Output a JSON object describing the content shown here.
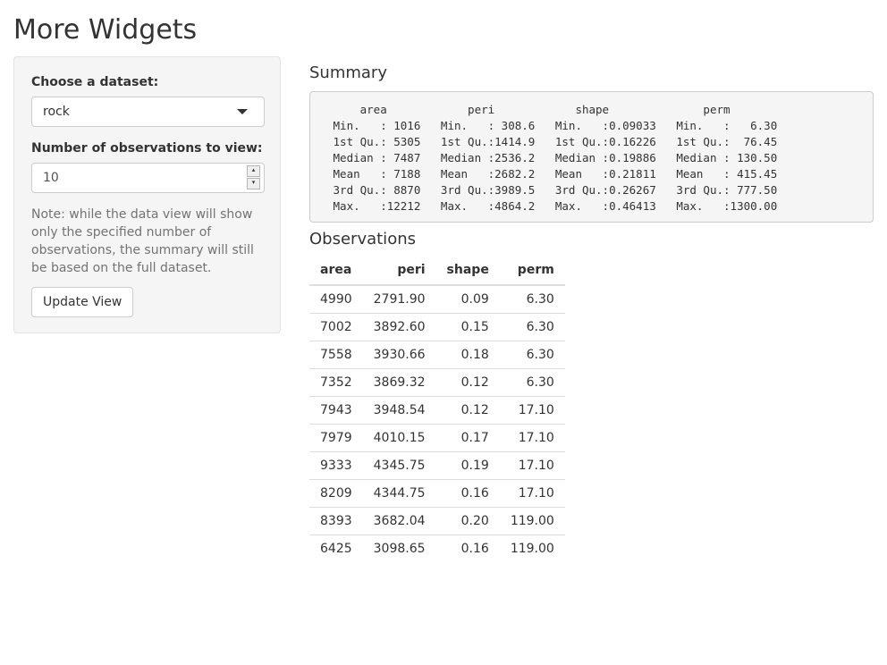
{
  "app": {
    "title": "More Widgets"
  },
  "sidebar": {
    "dataset_label": "Choose a dataset:",
    "dataset_value": "rock",
    "obs_label": "Number of observations to view:",
    "obs_value": "10",
    "note": "Note: while the data view will show only the specified number of observations, the summary will still be based on the full dataset.",
    "update_button": "Update View"
  },
  "main": {
    "summary_heading": "Summary",
    "summary_text": "     area            peri            shape              perm        \n Min.   : 1016   Min.   : 308.6   Min.   :0.09033   Min.   :   6.30  \n 1st Qu.: 5305   1st Qu.:1414.9   1st Qu.:0.16226   1st Qu.:  76.45  \n Median : 7487   Median :2536.2   Median :0.19886   Median : 130.50  \n Mean   : 7188   Mean   :2682.2   Mean   :0.21811   Mean   : 415.45  \n 3rd Qu.: 8870   3rd Qu.:3989.5   3rd Qu.:0.26267   3rd Qu.: 777.50  \n Max.   :12212   Max.   :4864.2   Max.   :0.46413   Max.   :1300.00  ",
    "observations_heading": "Observations",
    "table": {
      "columns": [
        "area",
        "peri",
        "shape",
        "perm"
      ],
      "rows": [
        [
          "4990",
          "2791.90",
          "0.09",
          "6.30"
        ],
        [
          "7002",
          "3892.60",
          "0.15",
          "6.30"
        ],
        [
          "7558",
          "3930.66",
          "0.18",
          "6.30"
        ],
        [
          "7352",
          "3869.32",
          "0.12",
          "6.30"
        ],
        [
          "7943",
          "3948.54",
          "0.12",
          "17.10"
        ],
        [
          "7979",
          "4010.15",
          "0.17",
          "17.10"
        ],
        [
          "9333",
          "4345.75",
          "0.19",
          "17.10"
        ],
        [
          "8209",
          "4344.75",
          "0.16",
          "17.10"
        ],
        [
          "8393",
          "3682.04",
          "0.20",
          "119.00"
        ],
        [
          "6425",
          "3098.65",
          "0.16",
          "119.00"
        ]
      ]
    }
  },
  "icons": {
    "select_caret": "chevron-down-icon",
    "spin_up": "spin-up-icon",
    "spin_down": "spin-down-icon"
  }
}
